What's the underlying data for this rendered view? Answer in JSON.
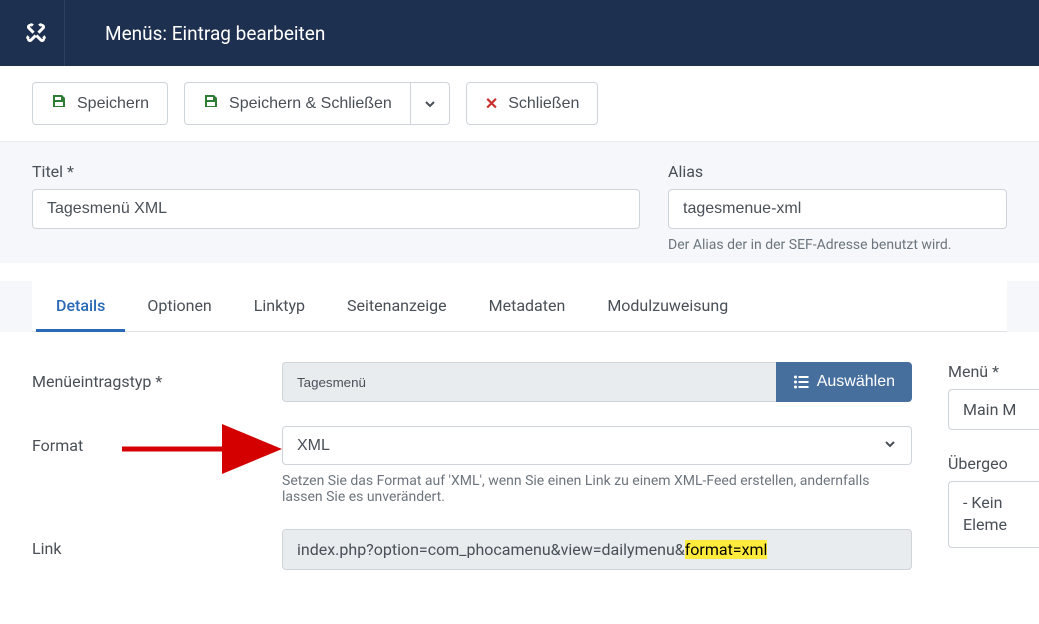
{
  "header": {
    "title": "Menüs: Eintrag bearbeiten"
  },
  "toolbar": {
    "save": "Speichern",
    "saveClose": "Speichern & Schließen",
    "close": "Schließen"
  },
  "titleField": {
    "label": "Titel *",
    "value": "Tagesmenü XML"
  },
  "aliasField": {
    "label": "Alias",
    "value": "tagesmenue-xml",
    "help": "Der Alias der in der SEF-Adresse benutzt wird."
  },
  "tabs": [
    "Details",
    "Optionen",
    "Linktyp",
    "Seitenanzeige",
    "Metadaten",
    "Modulzuweisung"
  ],
  "form": {
    "menuTypeLabel": "Menüeintragstyp *",
    "menuTypeValue": "Tagesmenü",
    "selectBtn": "Auswählen",
    "formatLabel": "Format",
    "formatValue": "XML",
    "formatHelp": "Setzen Sie das Format auf 'XML', wenn Sie einen Link zu einem XML-Feed erstellen, andernfalls lassen Sie es unverändert.",
    "linkLabel": "Link",
    "linkPrefix": "index.php?option=com_phocamenu&view=dailymenu&",
    "linkMark": "format=xml"
  },
  "side": {
    "menuLabel": "Menü *",
    "menuValue": "Main M",
    "parentLabel": "Übergeo",
    "parentLine1": "- Kein",
    "parentLine2": "Eleme"
  }
}
